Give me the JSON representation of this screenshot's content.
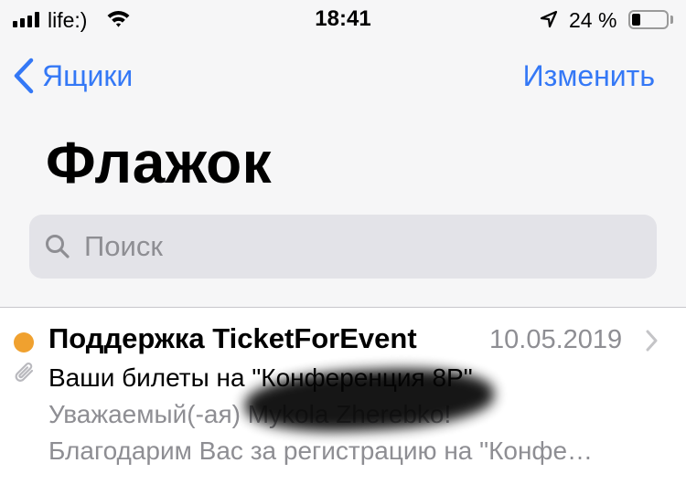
{
  "status_bar": {
    "carrier": "life:)",
    "time": "18:41",
    "battery_percent": "24 %",
    "battery_level": 0.24,
    "icons": [
      "signal-icon",
      "wifi-icon",
      "location-arrow-icon",
      "battery-icon"
    ]
  },
  "nav": {
    "back_label": "Ящики",
    "edit_label": "Изменить"
  },
  "title": "Флажок",
  "search": {
    "value": "",
    "placeholder": "Поиск"
  },
  "messages": [
    {
      "sender": "Поддержка TicketForEvent",
      "date": "10.05.2019",
      "subject": "Ваши билеты на \"Конференция 8P\"",
      "preview_line_1": "Уважаемый(-ая) Mykola Zherebko!",
      "preview_line_2": "Благодарим Вас за регистрацию на \"Конфе…",
      "unread": true,
      "has_attachment": true
    }
  ],
  "colors": {
    "accent": "#3478f6",
    "unread_dot": "#f0a12f",
    "secondary_text": "#8e8e93",
    "search_background": "#e3e3e8",
    "header_background": "#f6f6f7"
  }
}
